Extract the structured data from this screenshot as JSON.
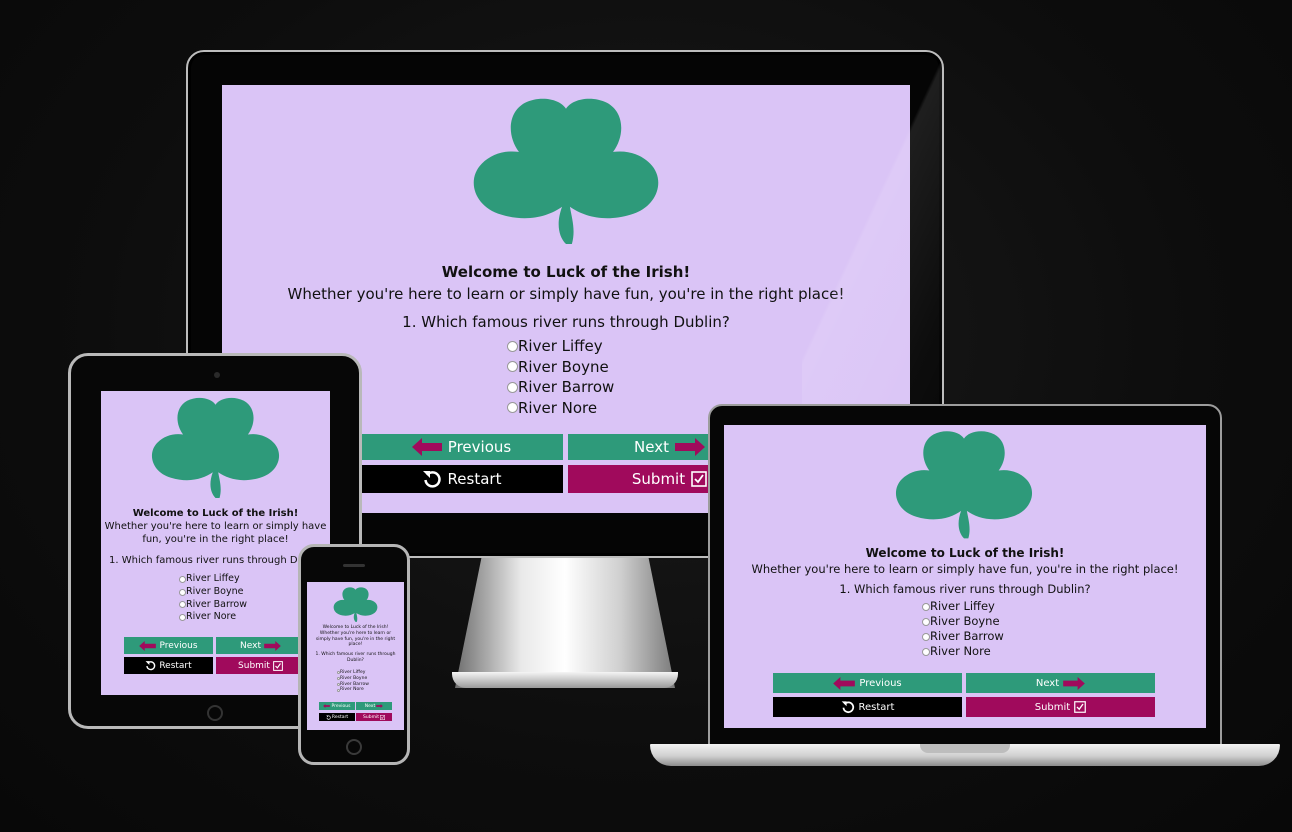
{
  "app": {
    "welcome": "Welcome to Luck of the Irish!",
    "intro": "Whether you're here to learn or simply have fun, you're in the right place!",
    "question": "1. Which famous river runs through Dublin?",
    "options": [
      "River Liffey",
      "River Boyne",
      "River Barrow",
      "River Nore"
    ],
    "buttons": {
      "previous": "Previous",
      "next": "Next",
      "restart": "Restart",
      "submit": "Submit"
    },
    "colors": {
      "background": "#dac4f6",
      "shamrock": "#2e9a7a",
      "primary_button": "#2e9a7a",
      "restart_button": "#000000",
      "submit_button": "#a00a5c",
      "arrow": "#a00a5c"
    },
    "icons": [
      "shamrock-icon",
      "arrow-left-icon",
      "arrow-right-icon",
      "restart-icon",
      "checkbox-icon"
    ]
  }
}
